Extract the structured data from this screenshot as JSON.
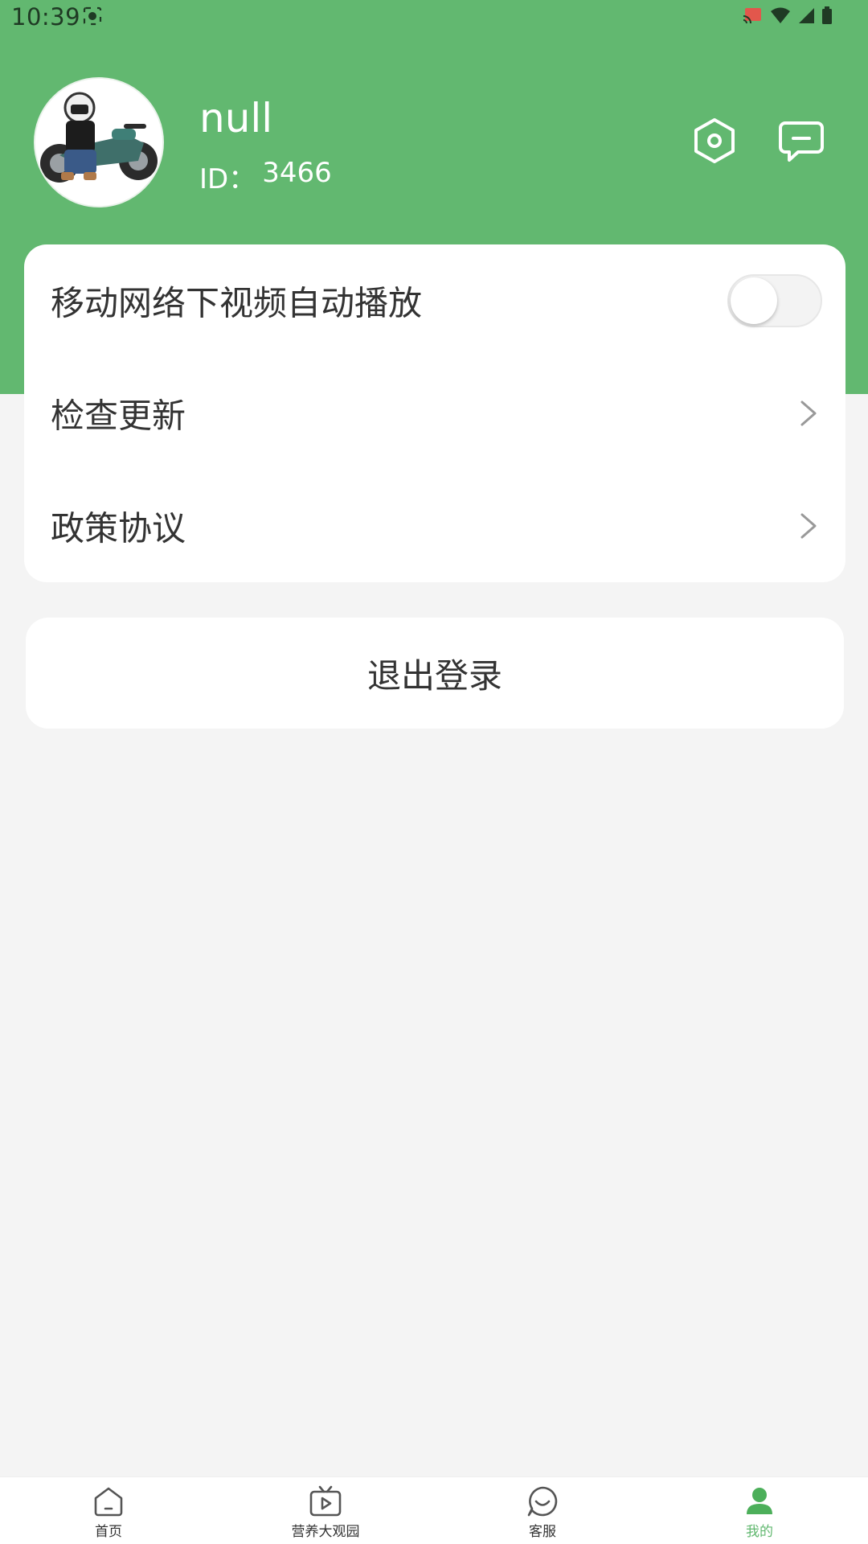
{
  "status_bar": {
    "time": "10:39"
  },
  "profile": {
    "name": "null",
    "id_label": "ID：",
    "id_value": "3466"
  },
  "colors": {
    "header_green": "#62b870",
    "background": "#f4f4f4",
    "text": "#333333"
  },
  "settings": {
    "items": [
      {
        "label": "移动网络下视频自动播放",
        "type": "toggle",
        "on": false
      },
      {
        "label": "检查更新",
        "type": "link",
        "icon": "chevron-right-icon"
      },
      {
        "label": "政策协议",
        "type": "link",
        "icon": "chevron-right-icon"
      }
    ]
  },
  "logout": {
    "label": "退出登录"
  },
  "bottom_nav": {
    "items": [
      {
        "label": "首页",
        "icon": "home-icon",
        "active": false
      },
      {
        "label": "营养大观园",
        "icon": "tv-play-icon",
        "active": false
      },
      {
        "label": "客服",
        "icon": "chat-smile-icon",
        "active": false
      },
      {
        "label": "我的",
        "icon": "user-icon",
        "active": true
      }
    ]
  }
}
